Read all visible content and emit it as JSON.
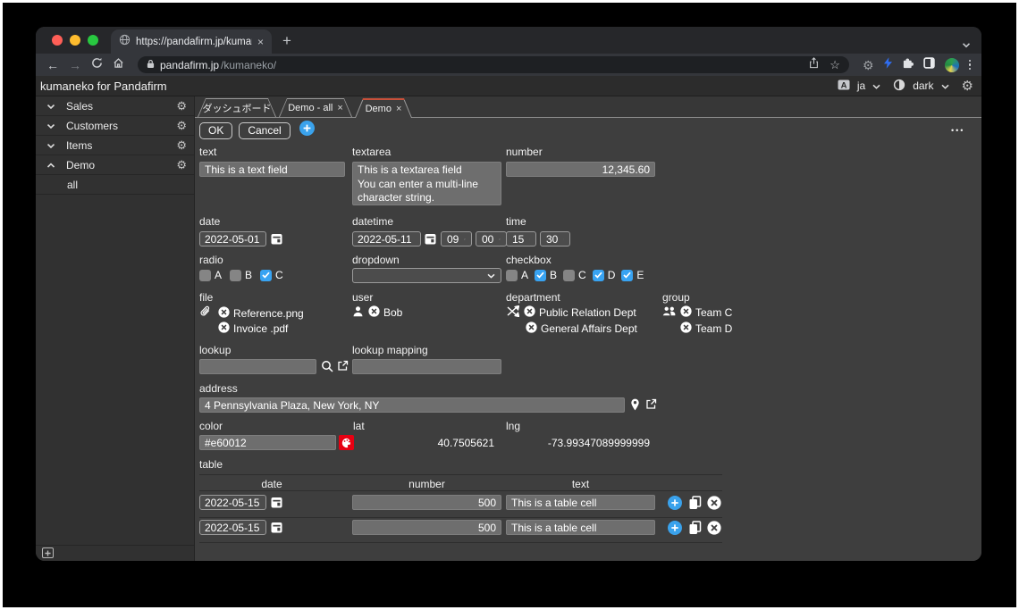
{
  "browser": {
    "tab_title": "https://pandafirm.jp/kumaneko",
    "url": {
      "domain": "pandafirm.jp",
      "path": "/kumaneko/"
    }
  },
  "app_header": {
    "title": "kumaneko for Pandafirm",
    "language": "ja",
    "theme": "dark"
  },
  "sidebar": {
    "items": [
      {
        "label": "Sales",
        "expanded": false
      },
      {
        "label": "Customers",
        "expanded": false
      },
      {
        "label": "Items",
        "expanded": false
      },
      {
        "label": "Demo",
        "expanded": true
      }
    ],
    "sub_items": [
      {
        "label": "all"
      }
    ]
  },
  "view_tabs": [
    {
      "label": "ダッシュボード",
      "closable": false,
      "active": false
    },
    {
      "label": "Demo - all",
      "closable": true,
      "active": false
    },
    {
      "label": "Demo",
      "closable": true,
      "active": true
    }
  ],
  "toolbar": {
    "ok": "OK",
    "cancel": "Cancel",
    "more": "•••"
  },
  "form": {
    "text": {
      "label": "text",
      "value": "This is a text field"
    },
    "textarea": {
      "label": "textarea",
      "value": "This is a textarea field\nYou can enter a multi-line\ncharacter string."
    },
    "number": {
      "label": "number",
      "value": "12,345.60"
    },
    "date": {
      "label": "date",
      "value": "2022-05-01"
    },
    "datetime": {
      "label": "datetime",
      "date": "2022-05-11",
      "hour": "09",
      "minute": "00"
    },
    "time": {
      "label": "time",
      "hour": "15",
      "minute": "30"
    },
    "radio": {
      "label": "radio",
      "options": [
        {
          "label": "A",
          "checked": false
        },
        {
          "label": "B",
          "checked": false
        },
        {
          "label": "C",
          "checked": true
        }
      ]
    },
    "dropdown": {
      "label": "dropdown",
      "value": ""
    },
    "checkbox": {
      "label": "checkbox",
      "options": [
        {
          "label": "A",
          "checked": false
        },
        {
          "label": "B",
          "checked": true
        },
        {
          "label": "C",
          "checked": false
        },
        {
          "label": "D",
          "checked": true
        },
        {
          "label": "E",
          "checked": true
        }
      ]
    },
    "file": {
      "label": "file",
      "files": [
        {
          "name": "Reference.png"
        },
        {
          "name": "Invoice .pdf"
        }
      ]
    },
    "user": {
      "label": "user",
      "users": [
        {
          "name": "Bob"
        }
      ]
    },
    "department": {
      "label": "department",
      "departments": [
        {
          "name": "Public Relation Dept"
        },
        {
          "name": "General Affairs Dept"
        }
      ]
    },
    "group": {
      "label": "group",
      "groups": [
        {
          "name": "Team C"
        },
        {
          "name": "Team D"
        }
      ]
    },
    "lookup": {
      "label": "lookup",
      "value": ""
    },
    "lookup_mapping": {
      "label": "lookup mapping",
      "value": ""
    },
    "address": {
      "label": "address",
      "value": "4 Pennsylvania Plaza, New York, NY"
    },
    "color": {
      "label": "color",
      "value": "#e60012",
      "swatch": "#e60012"
    },
    "lat": {
      "label": "lat",
      "value": "40.7505621"
    },
    "lng": {
      "label": "lng",
      "value": "-73.99347089999999"
    },
    "table": {
      "label": "table",
      "columns": [
        "date",
        "number",
        "text"
      ],
      "rows": [
        {
          "date": "2022-05-15",
          "number": "500",
          "text": "This is a table cell"
        },
        {
          "date": "2022-05-15",
          "number": "500",
          "text": "This is a table cell"
        }
      ]
    }
  },
  "colors": {
    "accent_blue": "#3aa2ec",
    "active_tab_accent": "#c8503a",
    "color_button": "#e60012",
    "checkbox_on": "#38a3f2"
  }
}
